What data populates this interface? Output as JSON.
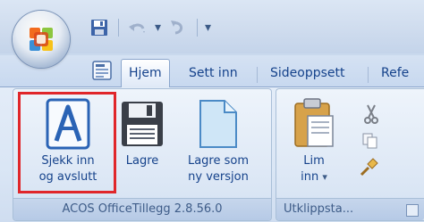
{
  "quick_access": {
    "save_icon": "save-icon",
    "undo_icon": "undo-icon",
    "redo_icon": "redo-icon",
    "customize_icon": "customize-qat-icon"
  },
  "tabs": [
    {
      "label": "Hjem",
      "active": true
    },
    {
      "label": "Sett inn",
      "active": false
    },
    {
      "label": "Sideoppsett",
      "active": false
    },
    {
      "label": "Refe",
      "active": false
    }
  ],
  "groups": {
    "acos": {
      "label": "ACOS OfficeTillegg 2.8.56.0",
      "buttons": [
        {
          "line1": "Sjekk inn",
          "line2": "og avslutt",
          "icon": "acos-a-icon"
        },
        {
          "line1": "Lagre",
          "line2": "",
          "icon": "floppy-disk-icon"
        },
        {
          "line1": "Lagre som",
          "line2": "ny versjon",
          "icon": "new-document-icon"
        }
      ]
    },
    "clipboard": {
      "label": "Utklippsta...",
      "paste": {
        "line1": "Lim",
        "line2": "inn",
        "dropdown": "▾"
      },
      "small_icons": [
        "scissors-icon",
        "copy-icon",
        "format-painter-icon"
      ]
    }
  },
  "colors": {
    "highlight_border": "#e0262a",
    "tab_text": "#15428b",
    "ribbon_bg": "#dae6f5"
  }
}
